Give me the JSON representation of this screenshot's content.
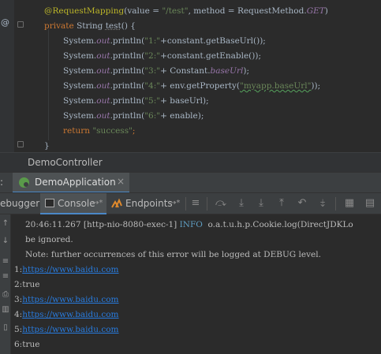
{
  "editor": {
    "gutter_marker": "@",
    "line1": {
      "annotation": "@RequestMapping",
      "open": "(value = ",
      "path": "\"/test\"",
      "mid": ", method = RequestMethod.",
      "get": "GET",
      "close": ")"
    },
    "line2": {
      "private": "private",
      "type": " String ",
      "name": "test",
      "rest": "() {"
    },
    "line3": {
      "sys": "System.",
      "out": "out",
      "call": ".println(",
      "str": "\"1:\"",
      "rest": "+constant.getBaseUrl());"
    },
    "line4": {
      "sys": "System.",
      "out": "out",
      "call": ".println(",
      "str": "\"2:\"",
      "rest": "+constant.getEnable());"
    },
    "line5": {
      "sys": "System.",
      "out": "out",
      "call": ".println(",
      "str": "\"3:\"",
      "mid": "+ Constant.",
      "fld": "baseUrl",
      "rest": ");"
    },
    "line6": {
      "sys": "System.",
      "out": "out",
      "call": ".println(",
      "str": "\"4:\"",
      "mid": "+ env.getProperty(",
      "arg": "\"myapp.baseUrl\"",
      "rest": "));"
    },
    "line7": {
      "sys": "System.",
      "out": "out",
      "call": ".println(",
      "str": "\"5:\"",
      "rest": "+ baseUrl);"
    },
    "line8": {
      "sys": "System.",
      "out": "out",
      "call": ".println(",
      "str": "\"6:\"",
      "rest": "+ enable);"
    },
    "line9": {
      "ret": "return",
      "str": "\"success\"",
      "semi": ";"
    },
    "line10": "}"
  },
  "breadcrumb": "DemoController",
  "run_bar": {
    "label": ":",
    "tab_label": "DemoApplication",
    "close": "×"
  },
  "console_toolbar": {
    "debugger_label": "ebugger",
    "console_label": "Console",
    "console_arrow": "→*",
    "endpoints_label": "Endpoints",
    "endpoints_arrow": "→*"
  },
  "console": {
    "log": {
      "time": "20:46:11.267",
      "thread": "[http-nio-8080-exec-1]",
      "level": "INFO",
      "msg": " o.a.t.u.h.p.Cookie.log(DirectJDKLo"
    },
    "log_cont": "be ignored.",
    "note": "Note: further occurrences of this error will be logged at DEBUG level.",
    "outputs": [
      {
        "prefix": "1:",
        "value": "https://www.baidu.com",
        "is_link": true
      },
      {
        "prefix": "2:",
        "value": "true",
        "is_link": false
      },
      {
        "prefix": "3:",
        "value": "https://www.baidu.com",
        "is_link": true
      },
      {
        "prefix": "4:",
        "value": "https://www.baidu.com",
        "is_link": true
      },
      {
        "prefix": "5:",
        "value": "https://www.baidu.com",
        "is_link": true
      },
      {
        "prefix": "6:",
        "value": "true",
        "is_link": false
      }
    ]
  },
  "colors": {
    "editor_bg": "#2b2b2b",
    "panel_bg": "#3c3f41",
    "link": "#287bde",
    "annotation": "#bbb529",
    "keyword": "#cc7832",
    "string": "#6a8759",
    "field": "#9876aa",
    "info": "#5f9ec2"
  }
}
